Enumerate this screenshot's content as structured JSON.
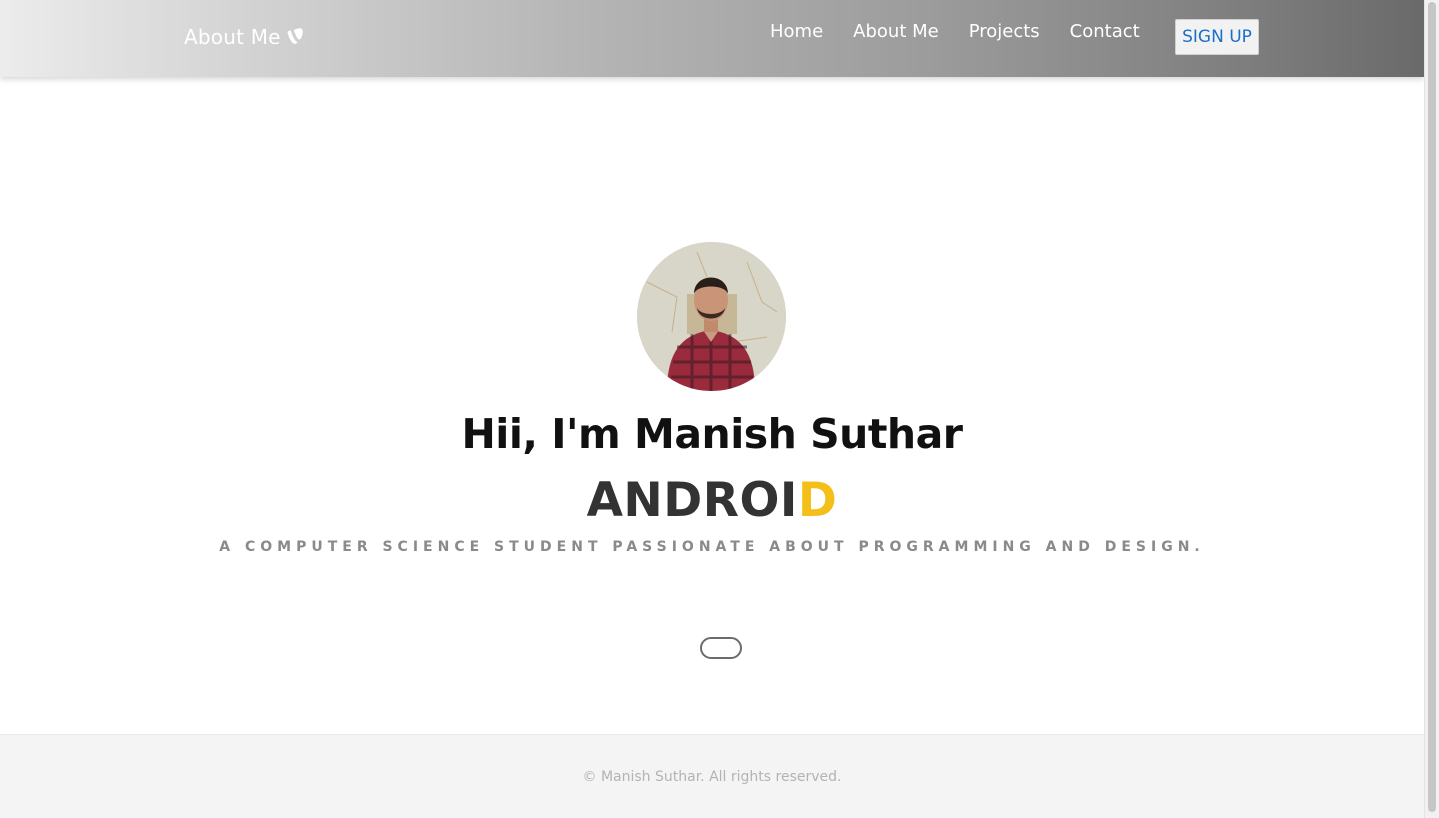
{
  "navbar": {
    "brand_label": "About Me",
    "brand_icon": "typo3-icon",
    "links": [
      {
        "label": "Home"
      },
      {
        "label": "About Me"
      },
      {
        "label": "Projects"
      },
      {
        "label": "Contact"
      }
    ],
    "signup_label": "SIGN UP"
  },
  "hero": {
    "avatar_icon": "profile-photo",
    "title": "Hii, I'm Manish Suthar",
    "role_typed": "ANDROI",
    "role_cursor": "D",
    "tagline": "A COMPUTER SCIENCE STUDENT PASSIONATE ABOUT PROGRAMMING AND DESIGN."
  },
  "footer": {
    "copyright": "© Manish Suthar. All rights reserved."
  },
  "colors": {
    "accent_yellow": "#f5bf1a",
    "signup_text": "#1a6fc9",
    "title_text": "#111111",
    "role_text": "#333333"
  }
}
